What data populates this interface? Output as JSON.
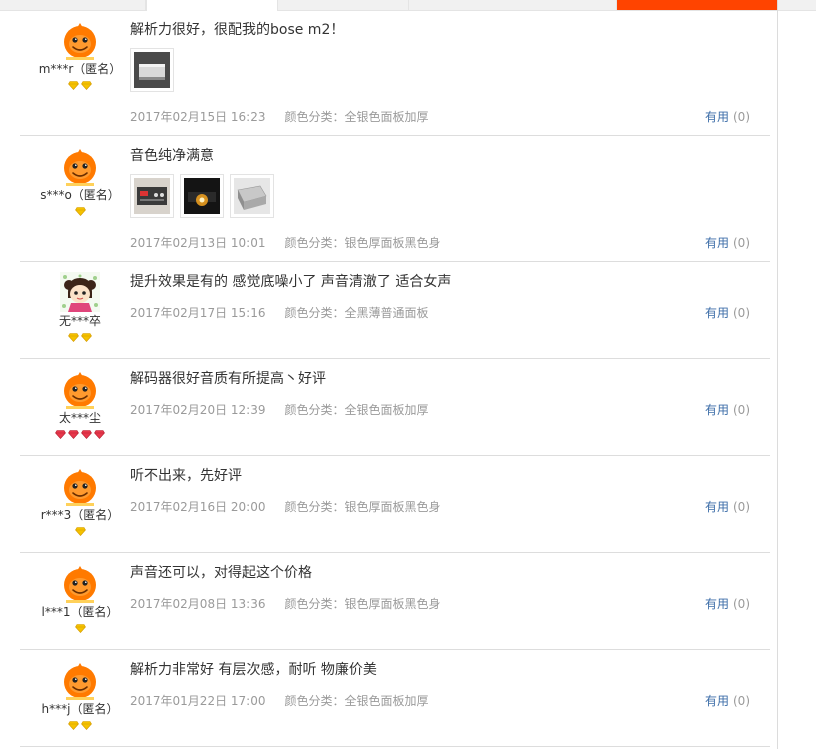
{
  "reviews": [
    {
      "user": "m***r（匿名）",
      "avatar": "default",
      "gems": [
        "yellow",
        "yellow"
      ],
      "content": "解析力很好，很配我的bose m2！",
      "photos": [
        "silver-box"
      ],
      "date": "2017年02月15日 16:23",
      "sku": "颜色分类：全银色面板加厚",
      "useful_label": "有用",
      "useful_count": "(0)"
    },
    {
      "user": "s***o（匿名）",
      "avatar": "default",
      "gems": [
        "yellow"
      ],
      "content": "音色纯净满意",
      "photos": [
        "front-panel",
        "dark-lit",
        "silver-angle"
      ],
      "date": "2017年02月13日 10:01",
      "sku": "颜色分类：银色厚面板黑色身",
      "useful_label": "有用",
      "useful_count": "(0)"
    },
    {
      "user": "无***卒",
      "avatar": "custom",
      "gems": [
        "yellow",
        "yellow"
      ],
      "content": "提升效果是有的 感觉底噪小了 声音清澈了 适合女声",
      "photos": [],
      "date": "2017年02月17日 15:16",
      "sku": "颜色分类：全黑薄普通面板",
      "useful_label": "有用",
      "useful_count": "(0)"
    },
    {
      "user": "太***尘",
      "avatar": "default",
      "gems": [
        "red",
        "red",
        "red",
        "red"
      ],
      "content": "解码器很好音质有所提高丶好评",
      "photos": [],
      "date": "2017年02月20日 12:39",
      "sku": "颜色分类：全银色面板加厚",
      "useful_label": "有用",
      "useful_count": "(0)"
    },
    {
      "user": "r***3（匿名）",
      "avatar": "default",
      "gems": [
        "yellow"
      ],
      "content": "听不出来，先好评",
      "photos": [],
      "date": "2017年02月16日 20:00",
      "sku": "颜色分类：银色厚面板黑色身",
      "useful_label": "有用",
      "useful_count": "(0)"
    },
    {
      "user": "l***1（匿名）",
      "avatar": "default",
      "gems": [
        "yellow"
      ],
      "content": "声音还可以，对得起这个价格",
      "photos": [],
      "date": "2017年02月08日 13:36",
      "sku": "颜色分类：银色厚面板黑色身",
      "useful_label": "有用",
      "useful_count": "(0)"
    },
    {
      "user": "h***j（匿名）",
      "avatar": "default",
      "gems": [
        "yellow",
        "yellow"
      ],
      "content": "解析力非常好 有层次感，耐听 物廉价美",
      "photos": [],
      "date": "2017年01月22日 17:00",
      "sku": "颜色分类：全银色面板加厚",
      "useful_label": "有用",
      "useful_count": "(0)"
    }
  ],
  "colors": {
    "accent_tab": "#ff4400",
    "link": "#3c6da8",
    "meta": "#9a9a9a",
    "gem_yellow": "#f5c200",
    "gem_red": "#e8384c"
  }
}
